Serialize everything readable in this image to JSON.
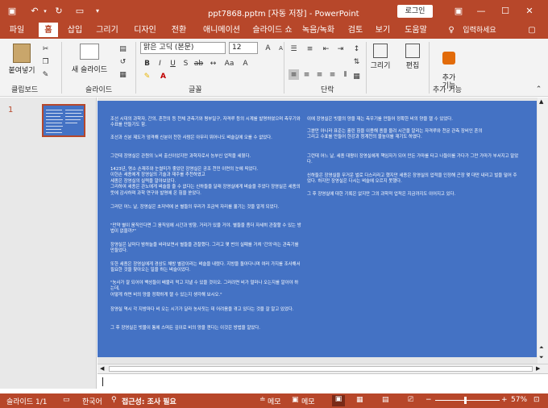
{
  "titlebar": {
    "title": "ppt7868.pptm [자동 저장] - PowerPoint",
    "login": "로그인",
    "icons": [
      "save-icon",
      "undo-icon",
      "redo-icon",
      "slideshow-icon",
      "ribbon-options-icon",
      "minimize-icon",
      "maximize-icon",
      "close-icon"
    ]
  },
  "tabs": [
    "파일",
    "홈",
    "삽입",
    "그리기",
    "디자인",
    "전환",
    "애니메이션",
    "슬라이드 쇼",
    "녹음/녹화",
    "검토",
    "보기",
    "도움말"
  ],
  "tell_me": "입력하세요",
  "ribbon": {
    "paste": "붙여넣기",
    "new_slide": "새 슬라이드",
    "font_name": "맑은 고딕 (본문)",
    "font_size": "12",
    "drawing": "그리기",
    "edit": "편집",
    "addin": "추가\n기능",
    "groups": {
      "clipboard": "클립보드",
      "slides": "슬라이드",
      "font": "글꼴",
      "paragraph": "단락",
      "addin": "추가 기능"
    }
  },
  "thumbnail": {
    "number": "1"
  },
  "slide": {
    "left": [
      "조선 시대의 과학자, 간의, 혼천의 등 천체 관측기와 평부일구, 자격루 등의 시계를 발명하였으며  측우기와 수표를 만들기도 함.",
      "조선과 신분 제도가 엄격해 신분이 천한 사람은 아무리 뛰어나도 벼슬길에 오를 수 없었다.",
      "그런데 장영실은 관원의 노비 출신이었지만 과학자로서 능부신 업적을 세웠다.",
      "1423년, 명소 손재주와 눈썰미가 좋았던 장영실은 공조 천민 이면의 눈에 띄었다.\n 이헌손 세종에게 장영실의 기술과 재주를 추천하였고\n 세종은 장영실의 실력을 알아보았다.\n 그리하여 세종은 관노에게 벼슬을 줄 수 없다는 신하들을 달래 장영실에게 벼슬을 주었다 장영실은 세종의 뜻에 감사하며 과학 연구와 발명에 온 힘을 쏟았다.",
      "그러던 어느 날, 장영실은 초저녁에 본 별들의 무리가 조금씩 자리를 옮기는 것을 알게 되었다.",
      "\"만약 별이 움직인다면 그 움직임에 시간과 방향, 거리가 있을 거야. 별들을 좀더 자세히 관찰할 수 있는 방법이 없을까?\"",
      "장영실은 날마다 밤하늘을 바라보면서 별들을 관찰했다. 그리고 몇 번의 실패를 거쳐 '간의'라는 관측기를 만들었다.",
      "또한 세종은 장영실에게 경상도 채방 별감이라는 벼슬을 내렸다. 지방을 돌아다니며 여러 가지를 조사해서 필요한 것을 찾아오는 일을 하는 벼슬이었다.",
      "\"농사가 잘 되어야 백성들이 배불리 먹고 지낼 수 있을 것이오. 그러려면 비가 얼마나 오는지를 알아야 하는데,\n 어떻게 하면 비의 양을 정확하게 잴 수 있는지 생각해 보시오.\"",
      "장영실 역시 각 지방마다 비 오는 시기가 달라 농사짓는 데 어려움을 겪고 있다는 것을 잘 알고 있었다.",
      "그 후 장영실은 빗물이 통에 스며든 깊이로 비의 양을 잰다는 이것은 방법을 알았다."
    ],
    "right": [
      "이에 장영실은 빗물의 양을 재는 측우기를 만들어 정확한 비의 양을 잴 수 있었다.",
      "그뿐만 아니라 표준는 흘린 힘을 이용해 종을 울려 시간을 알리는 자격루와 천문 관측 장비인 혼의\n 그리고 수표를 만들어 한강과 청계천의 물높이를 재기도 하였다.",
      "그런데 어느 날, 세종 대왕이 장영실에게 책임자가 되어 만든 가마를 타고 나들이를 가다가 그만 가마가 부서지고 말았다.",
      "신하들은 장영실을 무거운 벌로 다스리라고 했지만 세종은 장영실의 업적을 인정해 곤장 몇 대만 내리고 벌을 덜어 주었다. 하지만 장영실은 다시는 벼슬에 오르지 못했다.",
      "그 후 장영실에 대한 기록은 없지만 그의 과학적 업적은 지금까지도 이어지고 있다."
    ]
  },
  "statusbar": {
    "slide": "슬라이드 1/1",
    "lang": "한국어",
    "access": "접근성: 조사 필요",
    "notes1": "메모",
    "notes2": "메모",
    "zoom": "57%"
  }
}
